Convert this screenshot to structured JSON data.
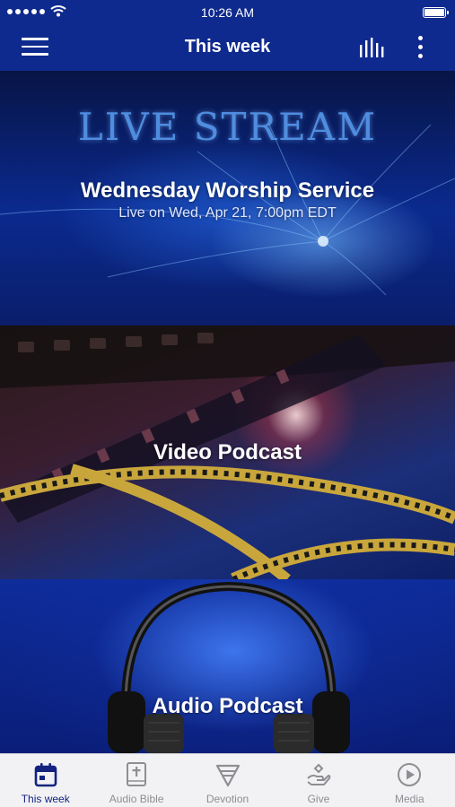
{
  "status_bar": {
    "time": "10:26 AM"
  },
  "nav": {
    "title": "This week"
  },
  "cards": {
    "live": {
      "heading": "LIVE STREAM",
      "title": "Wednesday Worship Service",
      "subtitle": "Live on Wed, Apr 21, 7:00pm EDT"
    },
    "video": {
      "title": "Video Podcast"
    },
    "audio": {
      "title": "Audio Podcast"
    }
  },
  "tabs": [
    {
      "label": "This week",
      "icon": "calendar-icon",
      "active": true
    },
    {
      "label": "Audio Bible",
      "icon": "bible-icon",
      "active": false
    },
    {
      "label": "Devotion",
      "icon": "devotion-icon",
      "active": false
    },
    {
      "label": "Give",
      "icon": "give-hand-icon",
      "active": false
    },
    {
      "label": "Media",
      "icon": "play-circle-icon",
      "active": false
    }
  ],
  "colors": {
    "nav_bg": "#0f2a8e",
    "tab_active": "#13237f",
    "tab_inactive": "#8e8e93"
  }
}
